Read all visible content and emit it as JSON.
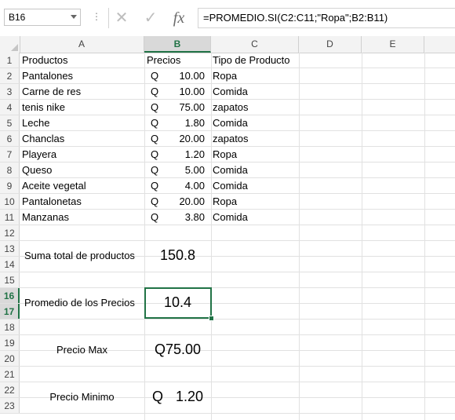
{
  "formula_bar": {
    "name_box": "B16",
    "dots": "⋮",
    "cancel_icon": "✕",
    "enter_icon": "✓",
    "fx_label": "fx",
    "formula": "=PROMEDIO.SI(C2:C11;\"Ropa\";B2:B11)"
  },
  "columns": [
    "A",
    "B",
    "C",
    "D",
    "E"
  ],
  "rows": [
    "1",
    "2",
    "3",
    "4",
    "5",
    "6",
    "7",
    "8",
    "9",
    "10",
    "11",
    "12",
    "13",
    "14",
    "15",
    "16",
    "17",
    "18",
    "19",
    "20",
    "21",
    "22",
    "23"
  ],
  "headers": {
    "a": "Productos",
    "b": "Precios",
    "c": "Tipo de Producto"
  },
  "currency": "Q",
  "products": [
    {
      "name": "Pantalones",
      "price": "10.00",
      "type": "Ropa"
    },
    {
      "name": "Carne de res",
      "price": "10.00",
      "type": "Comida"
    },
    {
      "name": "tenis nike",
      "price": "75.00",
      "type": "zapatos"
    },
    {
      "name": "Leche",
      "price": "1.80",
      "type": "Comida"
    },
    {
      "name": "Chanclas",
      "price": "20.00",
      "type": "zapatos"
    },
    {
      "name": "Playera",
      "price": "1.20",
      "type": "Ropa"
    },
    {
      "name": "Queso",
      "price": "5.00",
      "type": "Comida"
    },
    {
      "name": "Aceite vegetal",
      "price": "4.00",
      "type": "Comida"
    },
    {
      "name": "Pantalonetas",
      "price": "20.00",
      "type": "Ropa"
    },
    {
      "name": "Manzanas",
      "price": "3.80",
      "type": "Comida"
    }
  ],
  "summary": {
    "sum_label": "Suma total de productos",
    "sum_value": "150.8",
    "avg_label": "Promedio de los Precios",
    "avg_value": "10.4",
    "max_label": "Precio Max",
    "max_value": "Q75.00",
    "min_label": "Precio Minimo",
    "min_currency": "Q",
    "min_value": "1.20"
  },
  "colors": {
    "accent": "#217346"
  }
}
